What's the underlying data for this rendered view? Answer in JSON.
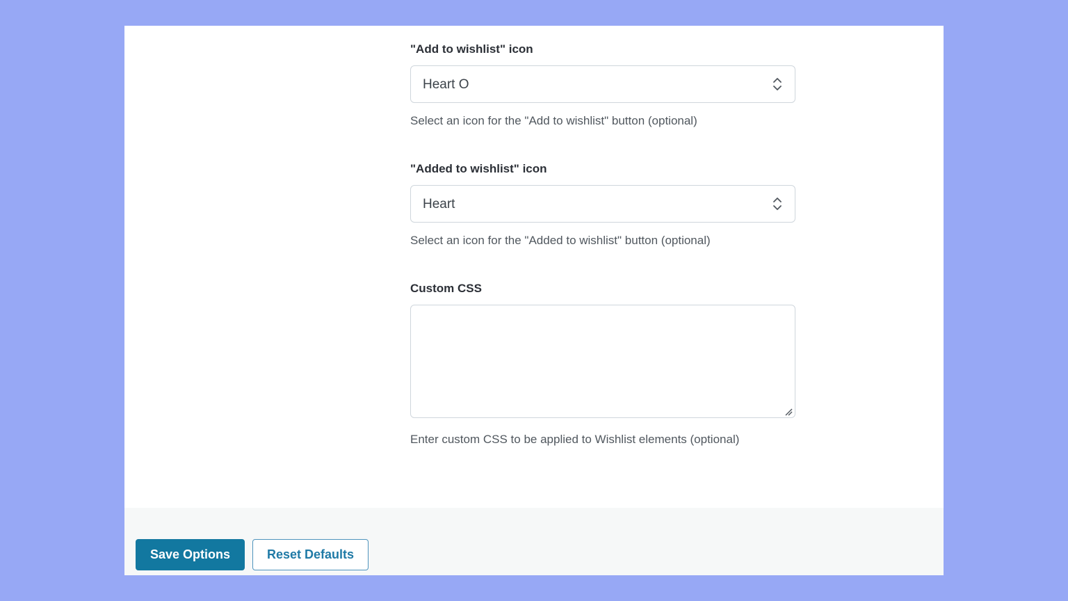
{
  "settings": {
    "add_icon": {
      "label": "\"Add to wishlist\" icon",
      "selected": "Heart O",
      "help": "Select an icon for the \"Add to wishlist\" button (optional)"
    },
    "added_icon": {
      "label": "\"Added to wishlist\" icon",
      "selected": "Heart",
      "help": "Select an icon for the \"Added to wishlist\" button (optional)"
    },
    "custom_css": {
      "label": "Custom CSS",
      "value": "",
      "help": "Enter custom CSS to be applied to Wishlist elements (optional)"
    }
  },
  "footer": {
    "save_label": "Save Options",
    "reset_label": "Reset Defaults"
  },
  "colors": {
    "background": "#97a8f5",
    "primary_button": "#1278a0",
    "secondary_button_text": "#1f7aa6"
  },
  "icons": {
    "select_arrows": "updown-chevron-icon",
    "textarea_resize": "resize-handle-icon"
  }
}
